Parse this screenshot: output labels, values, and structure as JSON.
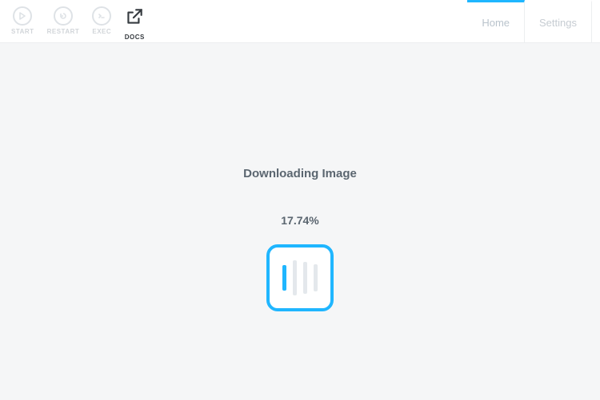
{
  "toolbar": {
    "start_label": "START",
    "restart_label": "RESTART",
    "exec_label": "EXEC",
    "docs_label": "DOCS"
  },
  "tabs": {
    "home_label": "Home",
    "settings_label": "Settings"
  },
  "status": {
    "title": "Downloading Image",
    "percent": "17.74%"
  },
  "colors": {
    "accent": "#1fb6ff"
  }
}
